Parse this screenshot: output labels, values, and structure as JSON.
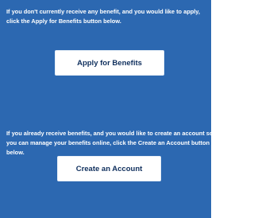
{
  "benefits": {
    "apply_text": "If you don't currently receive any benefit, and you would like to apply, click the Apply for Benefits button below.",
    "apply_button_label": "Apply for Benefits"
  },
  "account": {
    "create_text": "If you already receive benefits, and you would like to create an account so you can manage your benefits online, click the Create an Account button below.",
    "create_button_label": "Create an Account"
  },
  "colors": {
    "panel_background": "#2c68b1",
    "button_background": "#ffffff",
    "button_text": "#0f2f5d",
    "body_text": "#ffffff"
  }
}
